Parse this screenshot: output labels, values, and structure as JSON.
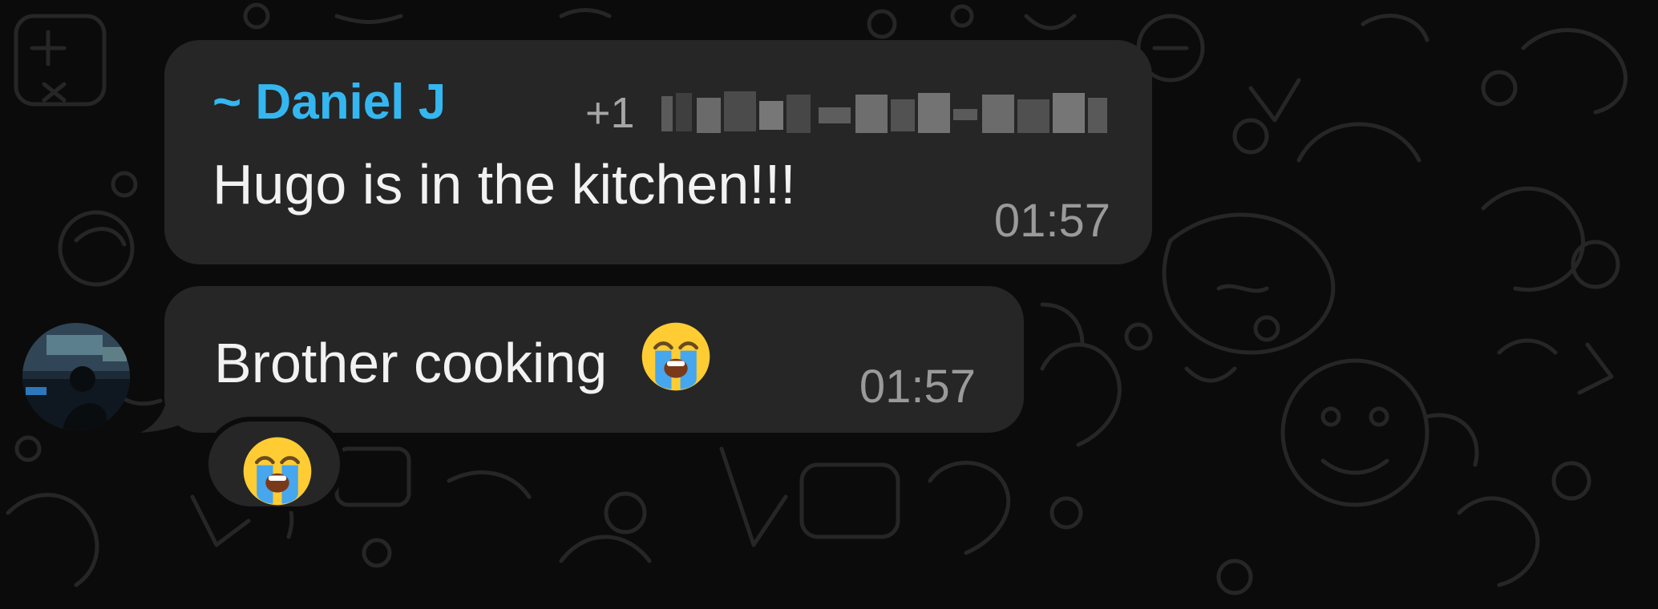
{
  "chat": {
    "messages": [
      {
        "sender": "~ Daniel J",
        "sender_phone_prefix": "+1",
        "text": "Hugo is in the kitchen!!!",
        "time": "01:57"
      },
      {
        "text": "Brother cooking",
        "emoji": "loudly-crying-face",
        "time": "01:57",
        "reaction": "loudly-crying-face"
      }
    ]
  },
  "colors": {
    "background": "#0b0b0b",
    "bubble": "#262626",
    "sender_name": "#34b7f1",
    "text": "#f2f2f2",
    "timestamp": "#9a9a9a"
  }
}
